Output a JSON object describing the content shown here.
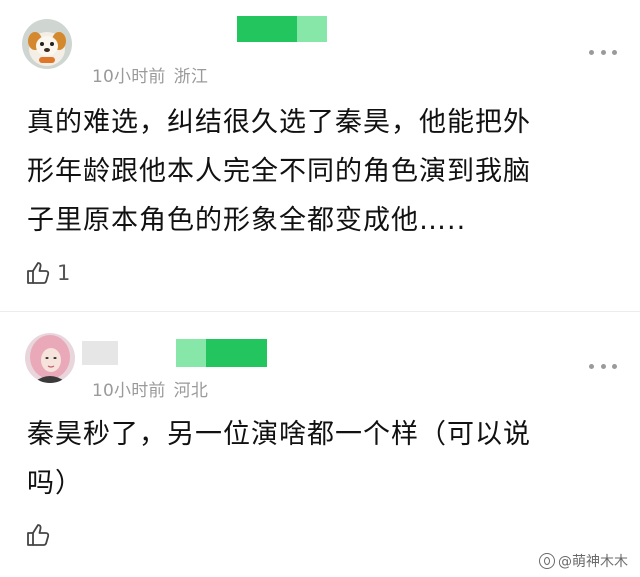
{
  "comments": [
    {
      "time": "10小时前",
      "location": "浙江",
      "lines": [
        "真的难选，纠结很久选了秦昊，他能把外",
        "形年龄跟他本人完全不同的角色演到我脑",
        "子里原本角色的形象全都变成他….."
      ],
      "like_count": "1",
      "icons": {
        "avatar": "dog-avatar",
        "more": "more-dots-icon",
        "like": "thumbs-up-icon"
      }
    },
    {
      "time": "10小时前",
      "location": "河北",
      "lines": [
        "秦昊秒了，另一位演啥都一个样（可以说",
        "吗）"
      ],
      "like_count": "",
      "icons": {
        "avatar": "girl-avatar",
        "more": "more-dots-icon",
        "like": "thumbs-up-icon"
      }
    }
  ],
  "watermark": "@萌神木木",
  "colors": {
    "meta_gray": "#9a9a9a",
    "name_green": "#22c55e",
    "name_green_light": "#86e7a9",
    "divider": "#ececec",
    "text": "#111111"
  }
}
